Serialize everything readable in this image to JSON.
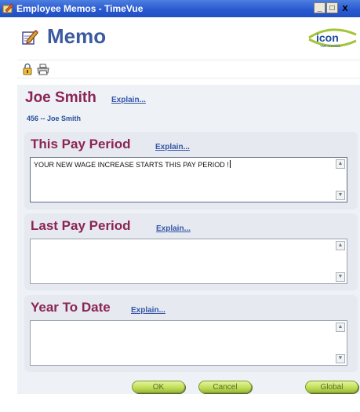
{
  "window": {
    "title": "Employee Memos - TimeVue",
    "btn_min": "_",
    "btn_max": "□",
    "btn_close": "x"
  },
  "header": {
    "title": "Memo",
    "logo_text": "icon",
    "logo_sub": "TIME SYSTEMS"
  },
  "employee": {
    "name": "Joe Smith",
    "explain": "Explain...",
    "id_line": "456 -- Joe Smith"
  },
  "sections": {
    "this_period": {
      "title": "This Pay Period",
      "explain": "Explain...",
      "text": "YOUR NEW WAGE INCREASE STARTS THIS PAY PERIOD !"
    },
    "last_period": {
      "title": "Last Pay Period",
      "explain": "Explain...",
      "text": ""
    },
    "ytd": {
      "title": "Year To Date",
      "explain": "Explain...",
      "text": ""
    }
  },
  "buttons": {
    "ok": "OK",
    "cancel": "Cancel",
    "global": "Global"
  },
  "colors": {
    "title_bar": "#2a5ad0",
    "section_title": "#8b2455",
    "button_green": "#c3de5a"
  }
}
